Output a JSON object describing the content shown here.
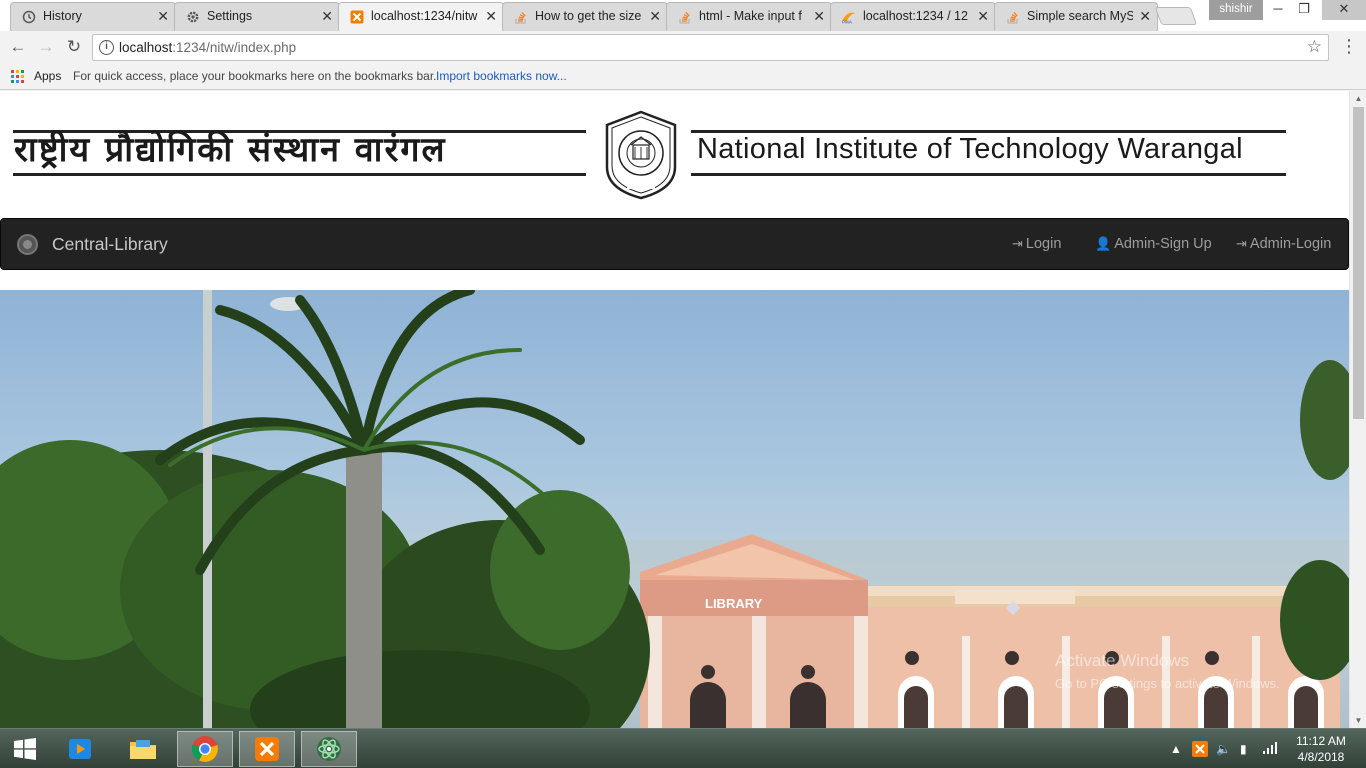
{
  "browser": {
    "tabs": [
      {
        "label": "History",
        "icon": "history-icon",
        "active": false
      },
      {
        "label": "Settings",
        "icon": "gear-icon",
        "active": false
      },
      {
        "label": "localhost:1234/nitw",
        "icon": "xampp-icon",
        "active": true
      },
      {
        "label": "How to get the size",
        "icon": "stackoverflow-icon",
        "active": false
      },
      {
        "label": "html - Make input f",
        "icon": "stackoverflow-icon",
        "active": false
      },
      {
        "label": "localhost:1234 / 12",
        "icon": "phpmyadmin-icon",
        "active": false
      },
      {
        "label": "Simple search MyS",
        "icon": "stackoverflow-icon",
        "active": false
      }
    ],
    "profile_name": "shishir",
    "address": {
      "host": "localhost",
      "path": ":1234/nitw/index.php"
    },
    "bookmarks": {
      "apps_label": "Apps",
      "hint": "For quick access, place your bookmarks here on the bookmarks bar.",
      "import_link": "Import bookmarks now..."
    }
  },
  "page": {
    "header": {
      "hindi_title": "राष्ट्रीय प्रौद्योगिकी संस्थान वारंगल",
      "english_title": "National Institute of Technology Warangal"
    },
    "navbar": {
      "brand": "Central-Library",
      "links": [
        {
          "label": "Login",
          "icon": "login-icon"
        },
        {
          "label": "Admin-Sign Up",
          "icon": "user-icon"
        },
        {
          "label": "Admin-Login",
          "icon": "login-icon"
        }
      ]
    },
    "hero": {
      "building_sign": "LIBRARY",
      "watermark_title": "Activate Windows",
      "watermark_sub": "Go to PC settings to activate Windows."
    }
  },
  "taskbar": {
    "time": "11:12 AM",
    "date": "4/8/2018"
  }
}
